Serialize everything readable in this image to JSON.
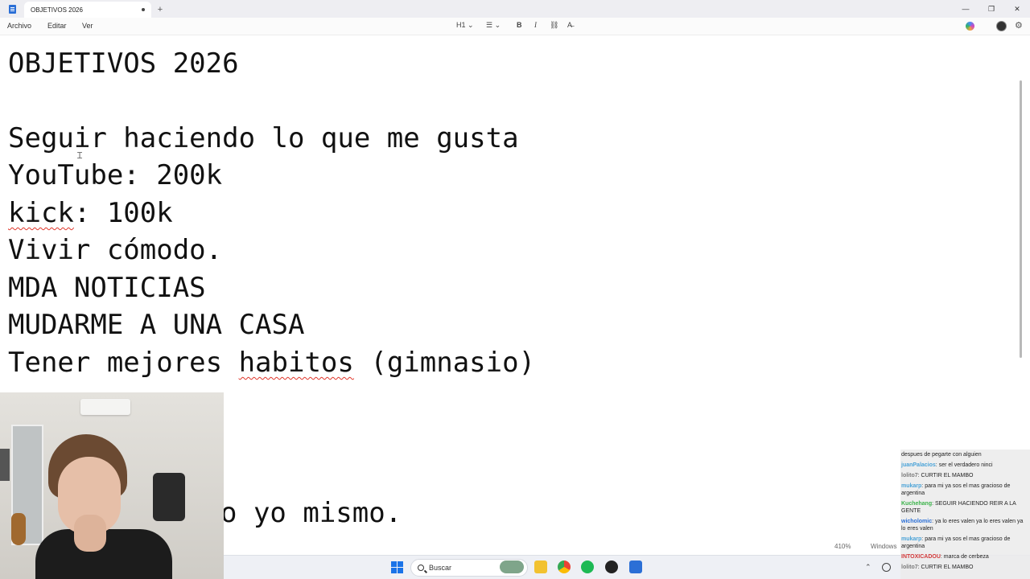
{
  "window": {
    "tab_title": "OBJETIVOS 2026",
    "new_tab_symbol": "+",
    "controls": [
      "—",
      "❐",
      "✕"
    ]
  },
  "menu": {
    "items": [
      "Archivo",
      "Editar",
      "Ver"
    ]
  },
  "toolbar": {
    "heading": "H1 ⌄",
    "list": "☰ ⌄",
    "bold": "B",
    "italic": "I",
    "link": "⛓",
    "clear_format": "A̶",
    "settings_glyph": "⚙"
  },
  "document": {
    "lines": [
      {
        "text": "OBJETIVOS 2026"
      },
      {
        "text": ""
      },
      {
        "text": "Seguir haciendo lo que me gusta"
      },
      {
        "text": "YouTube: 200k"
      },
      {
        "text": "kick",
        "tail": ": 100k"
      },
      {
        "text": "Vivir cómodo."
      },
      {
        "text": "MDA NOTICIAS"
      },
      {
        "text": "MUDARME A UNA CASA"
      },
      {
        "text": "Tener mejores ",
        "spell": "habitos",
        "tail": " (gimnasio)"
      }
    ],
    "partial_line": "o yo mismo."
  },
  "status": {
    "zoom": "410%",
    "encoding": "Windows"
  },
  "taskbar": {
    "search_placeholder": "Buscar",
    "tray_chevron": "⌃"
  },
  "chat": {
    "messages": [
      {
        "user": "",
        "text": "despues de pegarte con alguien",
        "color": "#222222"
      },
      {
        "user": "juanPalacios",
        "text": "ser el verdadero ninci",
        "color": "#4aa3d8"
      },
      {
        "user": "lolito7",
        "text": "CURTIR EL MAMBO",
        "color": "#7a7a7a"
      },
      {
        "user": "mukarp",
        "text": "para mi ya sos el mas gracioso de argentina",
        "color": "#4aa3d8"
      },
      {
        "user": "Kuchehang",
        "text": "SEGUIR HACIENDO REIR A LA GENTE",
        "color": "#3bb34a"
      },
      {
        "user": "wicholomic",
        "text": "ya lo eres valen ya lo eres valen ya lo eres valen",
        "color": "#2b6fd6"
      },
      {
        "user": "mukarp",
        "text": "para mi ya sos el mas gracioso de argentina",
        "color": "#4aa3d8"
      },
      {
        "user": "INTOXICADOU",
        "text": "marca de cerbeza",
        "color": "#d23a3a"
      },
      {
        "user": "lolito7",
        "text": "CURTIR EL MAMBO",
        "color": "#7a7a7a"
      }
    ]
  }
}
